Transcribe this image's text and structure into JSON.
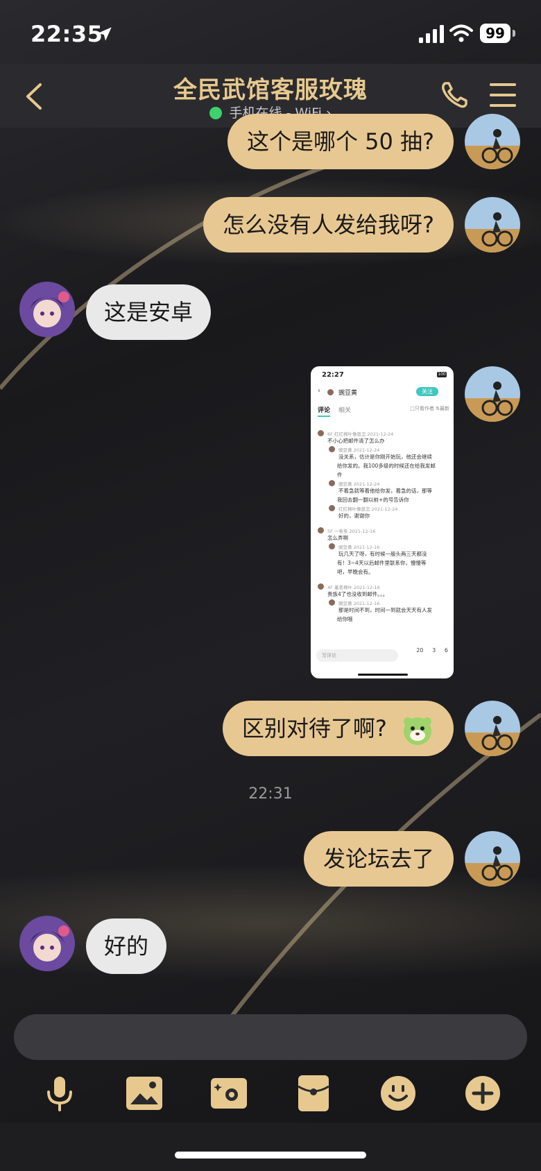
{
  "status_bar": {
    "time": "22:35",
    "battery": "99"
  },
  "header": {
    "title": "全民武馆客服玫瑰",
    "subtitle": "手机在线 - WiFi",
    "online_color": "#3ed16e",
    "accent_color": "#e7c98f"
  },
  "messages": [
    {
      "side": "right",
      "text": "这个是哪个 50 抽?"
    },
    {
      "side": "right",
      "text": "怎么没有人发给我呀?"
    },
    {
      "side": "left",
      "text": "这是安卓"
    },
    {
      "side": "right",
      "type": "image"
    },
    {
      "side": "right",
      "text": "区别对待了啊?",
      "sticker": "green-monster-sticker"
    },
    {
      "side": "right",
      "text": "发论坛去了"
    },
    {
      "side": "left",
      "text": "好的"
    }
  ],
  "timestamp": "22:31",
  "shared_screenshot": {
    "time": "22:27",
    "battery": "100",
    "username": "豌豆黄",
    "follow": "关注",
    "tab_comments": "评论",
    "tab_related": "相关",
    "filter_author": "只看作者",
    "filter_latest": "最新",
    "lines": [
      {
        "meta": "6F 红红棉叶像恩怎 2021-12-24",
        "text": "不小心把邮件清了怎么办"
      },
      {
        "meta": "豌豆黄 2021-12-24",
        "text": "没关系，估计是你刚开始玩，他还会继续"
      },
      {
        "meta": "",
        "text": "给你发的。我100多级的时候还在给我发邮"
      },
      {
        "meta": "",
        "text": "件"
      },
      {
        "meta": "豌豆黄 2021-12-24",
        "text": "不着急就等着他给你发，着急的话，那等"
      },
      {
        "meta": "",
        "text": "我回去翻一翻以前+的号告诉你"
      },
      {
        "meta": "红红棉叶像恩怎 2021-12-24",
        "text": "好的，谢谢你"
      },
      {
        "meta": "5F 一条条 2021-12-16",
        "text": "怎么弄啊"
      },
      {
        "meta": "豌豆黄 2021-12-16",
        "text": "玩几天了呀，有时候一般头两三天都没"
      },
      {
        "meta": "",
        "text": "有！3~4天以后邮件里联系你，慢慢等"
      },
      {
        "meta": "",
        "text": "吧，早晚会有。"
      },
      {
        "meta": "4F 墨茗棉叶 2021-12-16",
        "text": "贵族4了也没收到邮件。。。"
      },
      {
        "meta": "豌豆黄 2021-12-16",
        "text": "那是时间不到，时间一到就会天天有人发"
      },
      {
        "meta": "",
        "text": "给你哦"
      }
    ],
    "comment_placeholder": "写评论",
    "counts": [
      "20",
      "3",
      "6"
    ]
  }
}
